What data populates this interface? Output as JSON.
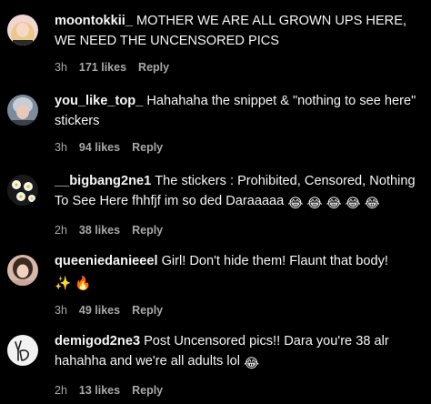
{
  "comments": [
    {
      "username": "moontokkii_",
      "text": "MOTHER WE ARE ALL GROWN UPS HERE, WE NEED THE UNCENSORED PICS",
      "time": "3h",
      "likes": "171 likes",
      "reply": "Reply",
      "avatar_icon": "avatar-blonde-person"
    },
    {
      "username": "you_like_top_",
      "text": "Hahahaha the snippet & \"nothing to see here\" stickers",
      "time": "3h",
      "likes": "94 likes",
      "reply": "Reply",
      "avatar_icon": "avatar-silver-hair-person"
    },
    {
      "username": "__bigbang2ne1",
      "text": "The stickers : Prohibited, Censored, Nothing To See Here fhhfjf im so ded Daraaaaa",
      "time": "2h",
      "likes": "38 likes",
      "reply": "Reply",
      "avatar_icon": "avatar-daisy-flowers",
      "trailing_emoji": "😂 😂 😂 😂 😂"
    },
    {
      "username": "queeniedanieeel",
      "text": "Girl! Don't hide them! Flaunt that body!",
      "time": "3h",
      "likes": "49 likes",
      "reply": "Reply",
      "avatar_icon": "avatar-dark-hair-person",
      "trailing_emoji": "✨ 🔥"
    },
    {
      "username": "demigod2ne3",
      "text": "Post Uncensored pics!! Dara you're 38 alr hahahha and we're all adults lol",
      "time": "2h",
      "likes": "13 likes",
      "reply": "Reply",
      "avatar_icon": "avatar-peace-hand",
      "trailing_emoji": "😂"
    }
  ]
}
